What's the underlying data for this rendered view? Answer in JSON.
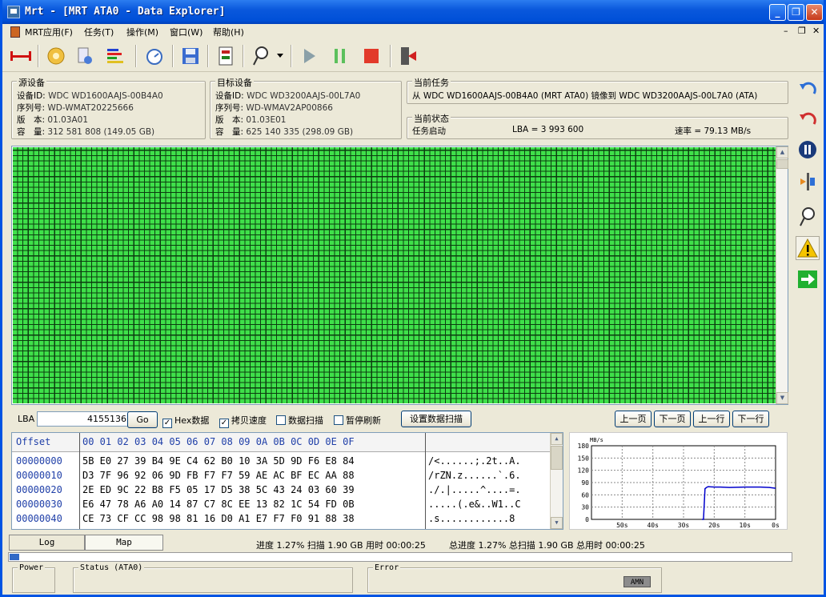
{
  "window": {
    "title": "Mrt - [MRT ATA0 - Data Explorer]"
  },
  "menu": {
    "items": [
      {
        "label": "MRT应用(F)"
      },
      {
        "label": "任务(T)"
      },
      {
        "label": "操作(M)"
      },
      {
        "label": "窗口(W)"
      },
      {
        "label": "帮助(H)"
      }
    ]
  },
  "toolbar": {
    "icons": [
      "connect-icon",
      "settings-gear-icon",
      "device-icon",
      "color-bars-icon",
      "timer-icon",
      "save-icon",
      "copy-card-icon",
      "probe-icon",
      "dropdown-arrow-icon",
      "play-icon",
      "pause-icon",
      "stop-icon",
      "exit-icon"
    ]
  },
  "source": {
    "title": "源设备",
    "rows": [
      {
        "label": "设备ID:",
        "value": "WDC WD1600AAJS-00B4A0"
      },
      {
        "label": "序列号:",
        "value": "WD-WMAT20225666"
      },
      {
        "label": "版　本:",
        "value": "01.03A01"
      },
      {
        "label": "容　量:",
        "value": "312 581 808 (149.05 GB)"
      }
    ]
  },
  "target": {
    "title": "目标设备",
    "rows": [
      {
        "label": "设备ID:",
        "value": "WDC WD3200AAJS-00L7A0"
      },
      {
        "label": "序列号:",
        "value": "WD-WMAV2AP00866"
      },
      {
        "label": "版　本:",
        "value": "01.03E01"
      },
      {
        "label": "容　量:",
        "value": "625 140 335 (298.09 GB)"
      }
    ]
  },
  "current_task": {
    "title": "当前任务",
    "text": "从 WDC WD1600AAJS-00B4A0 (MRT ATA0) 镜像到 WDC WD3200AAJS-00L7A0 (ATA)"
  },
  "current_status": {
    "title": "当前状态",
    "state": "任务启动",
    "lba": "LBA = 3 993 600",
    "rate": "速率 = 79.13 MB/s"
  },
  "lba_bar": {
    "label": "LBA",
    "value": "4155136",
    "go": "Go",
    "checks": [
      {
        "label": "Hex数据",
        "checked": true
      },
      {
        "label": "拷贝速度",
        "checked": true
      },
      {
        "label": "数据扫描",
        "checked": false
      },
      {
        "label": "暂停刷新",
        "checked": false
      }
    ],
    "scan_settings": "设置数据扫描",
    "nav": [
      "上一页",
      "下一页",
      "上一行",
      "下一行"
    ]
  },
  "hex": {
    "offset_header": "Offset",
    "columns": "00 01 02 03 04 05 06 07 08 09 0A 0B 0C 0D 0E 0F",
    "rows": [
      {
        "offset": "00000000",
        "bytes": "5B E0 27 39 B4 9E C4 62 B0 10 3A 5D 9D F6 E8 84",
        "ascii": "/<......;.2t..A."
      },
      {
        "offset": "00000010",
        "bytes": "D3 7F 96 92 06 9D FB F7 F7 59 AE AC BF EC AA 88",
        "ascii": "/rZN.z......`.6."
      },
      {
        "offset": "00000020",
        "bytes": "2E ED 9C 22 B8 F5 05 17 D5 38 5C 43 24 03 60 39",
        "ascii": "./.|.....^....=."
      },
      {
        "offset": "00000030",
        "bytes": "E6 47 78 A6 A0 14 87 C7 8C EE 13 82 1C 54 FD 0B",
        "ascii": ".....(.e&..W1..C"
      },
      {
        "offset": "00000040",
        "bytes": "CE 73 CF CC 98 98 81 16 D0 A1 E7 F7 F0 91 88 38",
        "ascii": ".s............8"
      }
    ]
  },
  "chart_data": {
    "type": "line",
    "ylabel": "MB/s",
    "ylim": [
      0,
      180
    ],
    "yticks": [
      "180",
      "150",
      "120",
      "90",
      "60",
      "30",
      "0"
    ],
    "xticks": [
      "50s",
      "40s",
      "30s",
      "20s",
      "10s",
      "0s"
    ],
    "grid": true,
    "series": [
      {
        "x": [
          -24,
          -23.5,
          -23,
          -22.5,
          -22,
          -20,
          -18,
          -15,
          -10,
          -5,
          -2,
          0
        ],
        "values": [
          0,
          0,
          75,
          78,
          80,
          79,
          79,
          78,
          79,
          79,
          78,
          76
        ]
      }
    ],
    "color": "#0000cc"
  },
  "tabs": [
    {
      "label": "Log"
    },
    {
      "label": "Map"
    }
  ],
  "progress": {
    "text": "进度 1.27% 扫描 1.90 GB 用时 00:00:25",
    "total_text": "总进度 1.27% 总扫描 1.90 GB 总用时 00:00:25",
    "percent": 1.27
  },
  "statusbar": {
    "panels": [
      {
        "label": "Power"
      },
      {
        "label": "Status (ATA0)"
      },
      {
        "label": "Error"
      }
    ],
    "amn": "AMN"
  },
  "sidebar_icons": [
    "undo-blue-icon",
    "undo-red-icon",
    "pause-circle-icon",
    "split-icon",
    "probe-icon",
    "warning-icon",
    "arrow-right-green-icon"
  ]
}
